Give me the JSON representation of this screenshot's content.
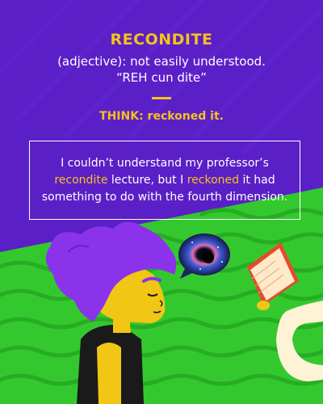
{
  "word": "RECONDITE",
  "definition": "(adjective): not easily understood.",
  "pronunciation": "“REH cun dite”",
  "think": "THINK: reckoned it.",
  "example": {
    "part1": "I couldn’t understand my professor’s",
    "highlight1": "recondite",
    "part2": " lecture, but I ",
    "highlight2": "reckoned",
    "part3": " it had something to do with the fourth dimension."
  },
  "colors": {
    "background": "#5b1fc7",
    "accent": "#f5c21b",
    "ground": "#33c92e",
    "hair": "#8a33ea"
  }
}
